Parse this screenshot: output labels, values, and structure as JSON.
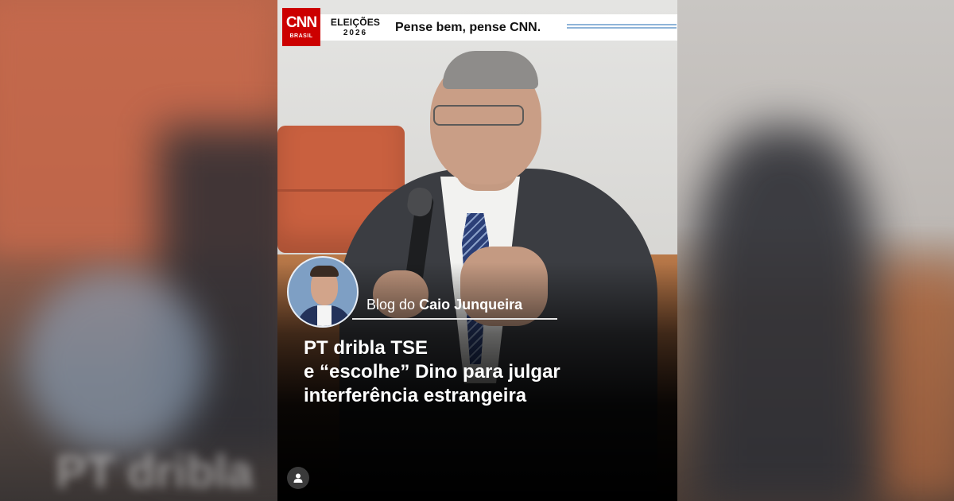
{
  "brand": {
    "logo_text": "CNN",
    "logo_subtext": "BRASIL",
    "campaign_line1": "ELEIÇÕES",
    "campaign_line2": "2026",
    "slogan": "Pense bem, pense CNN.",
    "accent_color": "#cc0000",
    "stripe_color": "#8fb4d8"
  },
  "blog": {
    "prefix": "Blog do",
    "author": "Caio Junqueira"
  },
  "headline": {
    "line1": "PT dribla TSE",
    "line2": "e “escolhe” Dino para julgar",
    "line3": "interferência estrangeira"
  },
  "background_ghost_text": "PT dribla",
  "icons": {
    "profile": "user-icon"
  }
}
